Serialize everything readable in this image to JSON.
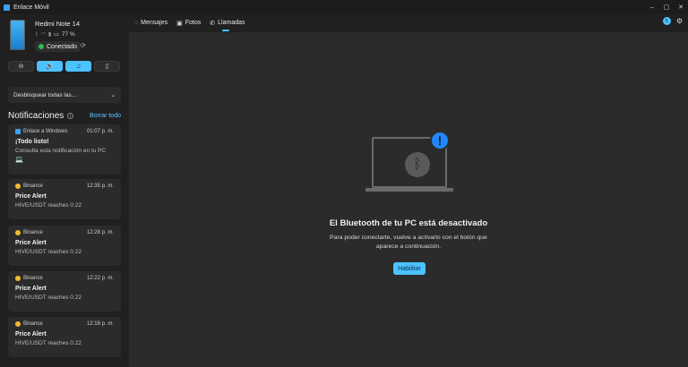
{
  "window": {
    "title": "Enlace Móvil",
    "controls": [
      "–",
      "▢",
      "✕"
    ]
  },
  "device": {
    "name": "Redmi Note 14",
    "battery": "77 %",
    "status": "Conectado"
  },
  "quick_actions": [
    {
      "icon": "dnd-icon",
      "glyph": "⊖",
      "active": false
    },
    {
      "icon": "volume-icon",
      "glyph": "🔊",
      "active": true
    },
    {
      "icon": "music-icon",
      "glyph": "♫",
      "active": true
    },
    {
      "icon": "battery-saver-icon",
      "glyph": "▯",
      "active": false
    }
  ],
  "sidebar": {
    "dropdown_label": "Desbloquear todas las..."
  },
  "notifications": {
    "title": "Notificaciones",
    "clear_label": "Borrar todo",
    "items": [
      {
        "app": "Enlace a Windows",
        "time": "01:07 p. m.",
        "title": "¡Todo listo!",
        "body": "Consulta esta notificación en tu PC",
        "extra": "💻"
      },
      {
        "app": "Binance",
        "time": "12:35 p. m.",
        "title": "Price Alert",
        "body": "HIVE/USDT reaches 0.22"
      },
      {
        "app": "Binance",
        "time": "12:28 p. m.",
        "title": "Price Alert",
        "body": "HIVE/USDT reaches 0.22"
      },
      {
        "app": "Binance",
        "time": "12:22 p. m.",
        "title": "Price Alert",
        "body": "HIVE/USDT reaches 0.22"
      },
      {
        "app": "Binance",
        "time": "12:16 p. m.",
        "title": "Price Alert",
        "body": "HIVE/USDT reaches 0.22"
      }
    ]
  },
  "tabs": [
    {
      "label": "Mensajes",
      "icon": "chat-icon"
    },
    {
      "label": "Fotos",
      "icon": "photos-icon"
    },
    {
      "label": "Llamadas",
      "icon": "phone-icon"
    }
  ],
  "header": {
    "notification_count": "5"
  },
  "main": {
    "title": "El Bluetooth de tu PC está desactivado",
    "body": "Para poder conectarte, vuelve a activarlo con el botón que aparece a continuación.",
    "button": "Habilitar"
  },
  "colors": {
    "accent": "#4cc2ff",
    "alert": "#1f88ff",
    "connected": "#2fbf4f"
  }
}
